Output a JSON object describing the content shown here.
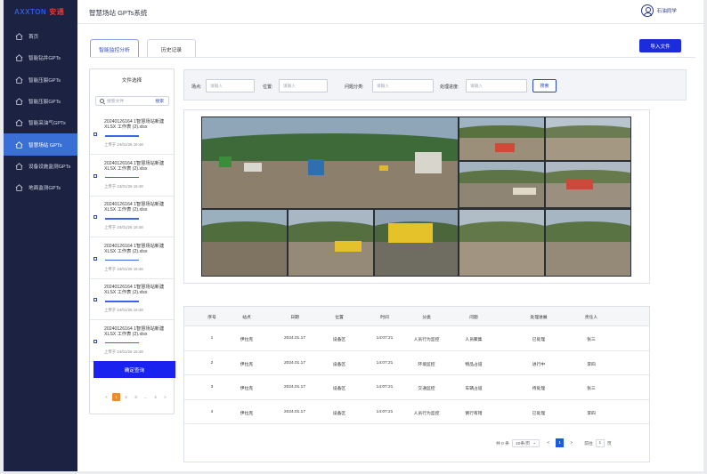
{
  "brand": {
    "en": "AXXTON",
    "cn": "安通"
  },
  "header": {
    "title": "智慧场站 GPTs系统",
    "user_name": "石油同学"
  },
  "sidebar": {
    "items": [
      {
        "label": "首页",
        "icon": "home-icon",
        "active": false
      },
      {
        "label": "智能钻井GPTs",
        "icon": "home-icon",
        "active": false
      },
      {
        "label": "智能压裂GPTs",
        "icon": "home-icon",
        "active": false
      },
      {
        "label": "智能压裂GPTs",
        "icon": "home-icon",
        "active": false
      },
      {
        "label": "智能采油气GPTs",
        "icon": "home-icon",
        "active": false
      },
      {
        "label": "智慧场站 GPTs",
        "icon": "home-icon",
        "active": true
      },
      {
        "label": "设备设施监测GPTs",
        "icon": "home-icon",
        "active": false
      },
      {
        "label": "地面监测GPTs",
        "icon": "home-icon",
        "active": false
      }
    ]
  },
  "tabs": [
    {
      "label": "智能监控分析",
      "active": true
    },
    {
      "label": "历史记录",
      "active": false
    }
  ],
  "import_button": "导入文件",
  "file_panel": {
    "title": "文件选择",
    "search_placeholder": "搜索文件",
    "search_button": "搜索",
    "files": [
      {
        "name": "20240126164 1智慧场站新建XLSX 工作表 (2).xlsx",
        "time": "上传于 24/01/26 16:48",
        "progress": 0.5
      },
      {
        "name": "20240126164 1智慧场站新建XLSX 工作表 (2).xlsx",
        "time": "上传于 24/01/26 16:48",
        "progress": 0.5
      },
      {
        "name": "20240126164 1智慧场站新建XLSX 工作表 (2).xlsx",
        "time": "上传于 24/01/26 16:48",
        "progress": 0.5
      },
      {
        "name": "20240126164 1智慧场站新建XLSX 工作表 (2).xlsx",
        "time": "上传于 24/01/26 16:48",
        "progress": 0.5
      },
      {
        "name": "20240126164 1智慧场站新建XLSX 工作表 (2).xlsx",
        "time": "上传于 24/01/26 16:48",
        "progress": 0.5
      },
      {
        "name": "20240126164 1智慧场站新建XLSX 工作表 (2).xlsx",
        "time": "上传于 24/01/26 16:48",
        "progress": 0.5
      }
    ],
    "confirm_button": "确定查询",
    "pager": [
      "<",
      "1",
      "2",
      "3",
      "...",
      "4",
      ">"
    ]
  },
  "filters": [
    {
      "label": "场点:",
      "placeholder": "请输入"
    },
    {
      "label": "位置:",
      "placeholder": "请输入"
    },
    {
      "label": "问题分类:",
      "placeholder": "请输入"
    },
    {
      "label": "处理进度:",
      "placeholder": "请输入"
    }
  ],
  "filter_search_button": "搜索",
  "table": {
    "columns": [
      "序号",
      "站点",
      "日期",
      "位置",
      "时间",
      "分类",
      "问题",
      "处理进展",
      "责任人"
    ],
    "rows": [
      [
        "1",
        "伊拉克",
        "2024.01.17",
        "设备区",
        "14:07:21",
        "人员行为监控",
        "人员聚集",
        "已处理",
        "张三"
      ],
      [
        "2",
        "伊拉克",
        "2024.01.17",
        "设备区",
        "14:07:21",
        "环境监控",
        "物品占道",
        "进行中",
        "李四"
      ],
      [
        "3",
        "伊拉克",
        "2024.01.17",
        "设备区",
        "14:07:21",
        "交通监控",
        "车辆占道",
        "待处理",
        "张三"
      ],
      [
        "4",
        "伊拉克",
        "2024.01.17",
        "设备区",
        "14:07:21",
        "人员行为监控",
        "倒行有错",
        "已处理",
        "李四"
      ]
    ]
  },
  "pagination": {
    "total": "共 0 条",
    "page_size": "10条/页",
    "prev": "<",
    "current": "1",
    "next": ">",
    "goto_label": "前往",
    "goto_value": "1",
    "page_unit": "页"
  }
}
